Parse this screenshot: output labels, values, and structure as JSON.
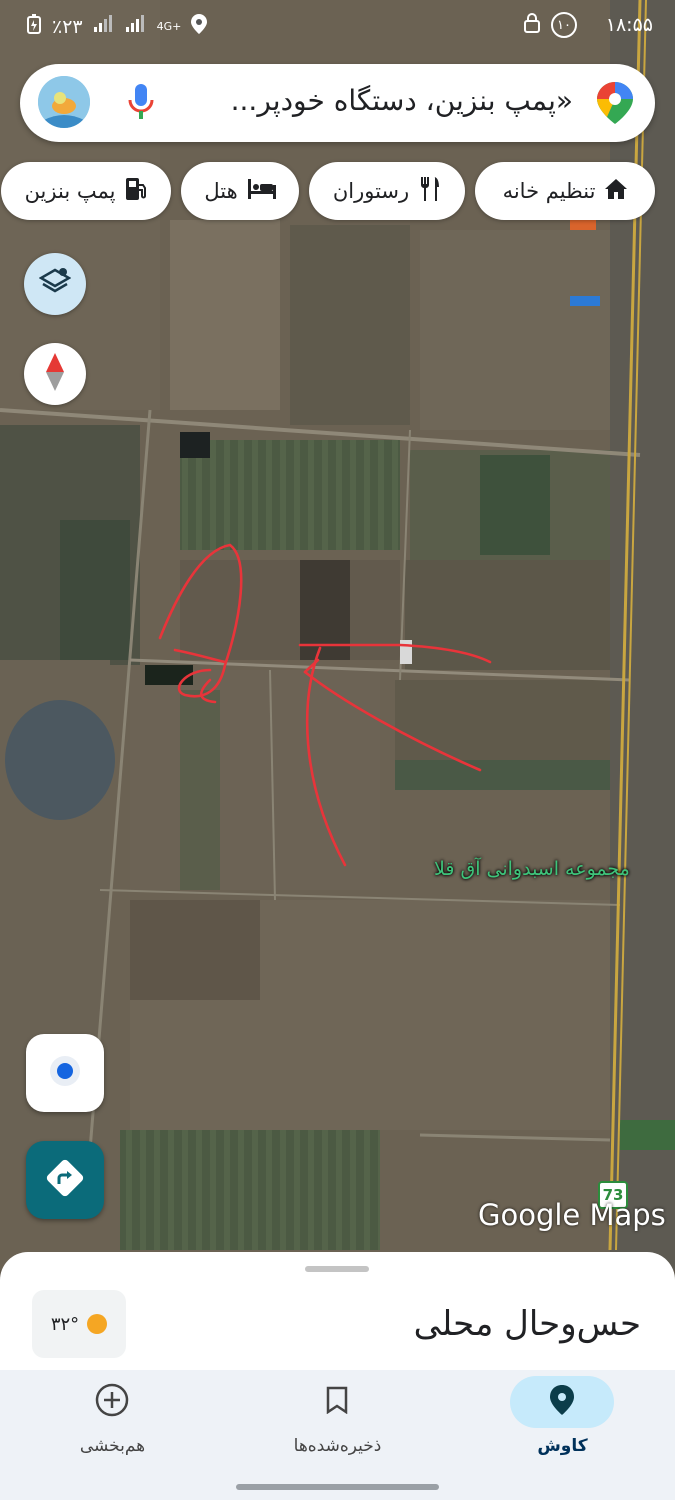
{
  "status_bar": {
    "time": "۱۸:۵۵",
    "battery": "٪۲۳",
    "notification_count": "۱۰",
    "network": "4G+"
  },
  "search": {
    "text": "«پمپ بنزین، دستگاه خودپر...",
    "avatar_icon": "profile-avatar",
    "mic_icon": "mic-icon",
    "maps_icon": "maps-pin-icon"
  },
  "chips": [
    {
      "label": "تنظیم خانه",
      "icon": "home-icon"
    },
    {
      "label": "رستوران",
      "icon": "restaurant-icon"
    },
    {
      "label": "هتل",
      "icon": "hotel-icon"
    },
    {
      "label": "پمپ بنزین",
      "icon": "gas-station-icon"
    }
  ],
  "map": {
    "place_label": "مجموعه اسبدوانی آق قلا",
    "road_shield": "73",
    "watermark": "Google Maps",
    "annotation_color": "#e8343a"
  },
  "sheet": {
    "title": "حس‌وحال محلی",
    "weather_temp": "۳۲°",
    "weather_icon": "sun-icon"
  },
  "nav": {
    "items": [
      {
        "label": "کاوش",
        "icon": "explore-pin-icon",
        "active": true
      },
      {
        "label": "ذخیره‌شده‌ها",
        "icon": "bookmark-icon",
        "active": false
      },
      {
        "label": "هم‌بخشی",
        "icon": "add-circle-icon",
        "active": false
      }
    ]
  },
  "colors": {
    "accent": "#0b6b7a",
    "nav_active_bg": "#c6eafb",
    "place_label": "#3ec37a"
  }
}
